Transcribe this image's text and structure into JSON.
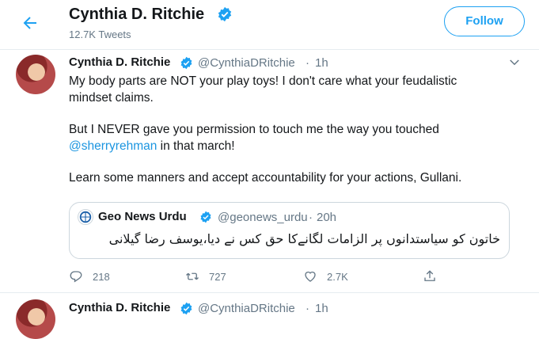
{
  "header": {
    "title": "Cynthia D. Ritchie",
    "tweet_count": "12.7K Tweets",
    "follow_label": "Follow",
    "back_icon": "back-arrow-icon",
    "accent": "#1da1f2"
  },
  "tweet": {
    "author": "Cynthia D. Ritchie",
    "handle": "@CynthiaDRitchie",
    "separator": "·",
    "time": "1h",
    "line1": "My body parts are NOT your play toys! I don't care what your feudalistic",
    "line2": "mindset claims.",
    "line3": "But I NEVER gave you permission to touch me the way you touched",
    "mention": "@sherryrehman",
    "line4_rest": " in that march!",
    "line5": "Learn some manners and accept accountability for your actions, Gullani.",
    "quote": {
      "author": "Geo News Urdu",
      "handle": "@geonews_urdu",
      "separator": "·",
      "time": "20h",
      "text": "خاتون کو سیاستدانوں پر الزامات لگانےکا حق کس نے دیا،یوسف رضا گیلانی"
    },
    "stats": {
      "replies": "218",
      "retweets": "727",
      "likes": "2.7K"
    }
  },
  "tweet2": {
    "author": "Cynthia D. Ritchie",
    "handle": "@CynthiaDRitchie",
    "separator": "·",
    "time": "1h"
  }
}
